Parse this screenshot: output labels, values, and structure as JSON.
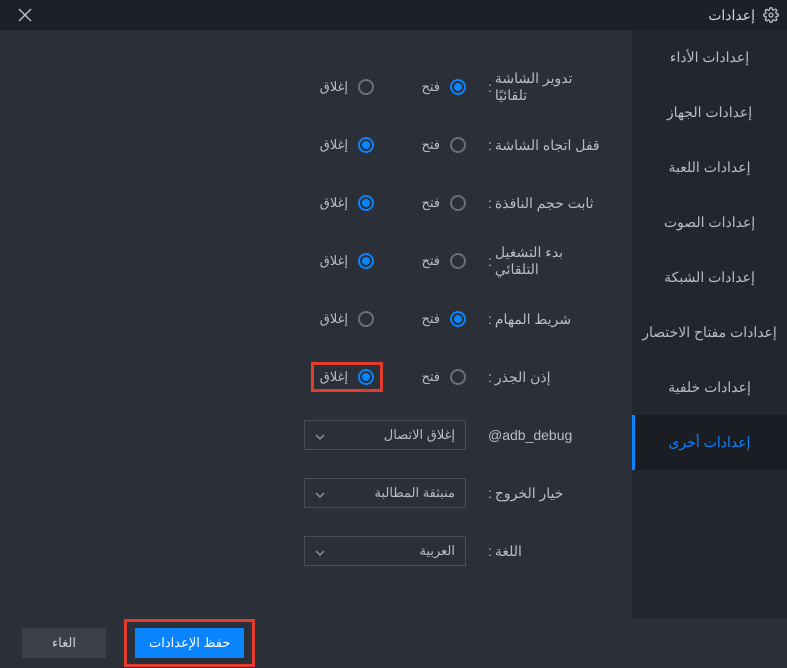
{
  "window": {
    "title": "إعدادات"
  },
  "sidebar": {
    "items": [
      {
        "label": "إعدادات الأداء"
      },
      {
        "label": "إعدادات الجهاز"
      },
      {
        "label": "إعدادات اللعبة"
      },
      {
        "label": "إعدادات الصوت"
      },
      {
        "label": "إعدادات الشبكة"
      },
      {
        "label": "إعدادات مفتاح الاختصار"
      },
      {
        "label": "إعدادات خلفية"
      },
      {
        "label": "إعدادات أخرى"
      }
    ]
  },
  "radios": {
    "open": "فتح",
    "close": "إغلاق"
  },
  "settings": {
    "auto_rotate": {
      "label": "تدوير الشاشة تلقائيًا",
      "value": "open"
    },
    "lock_orientation": {
      "label": "قفل اتجاه الشاشة",
      "value": "close"
    },
    "fixed_window": {
      "label": "ثابت حجم النافذة",
      "value": "close"
    },
    "auto_start": {
      "label": "بدء التشغيل التلقائي",
      "value": "close"
    },
    "taskbar": {
      "label": "شريط المهام",
      "value": "open"
    },
    "root": {
      "label": "إذن الجذر",
      "value": "close"
    },
    "adb": {
      "label": "@adb_debug",
      "selected": "إغلاق الاتصال"
    },
    "exit": {
      "label": "خيار الخروج",
      "selected": "منبثقة المطالبة"
    },
    "lang": {
      "label": "اللغة",
      "selected": "العربية"
    }
  },
  "footer": {
    "save": "حفظ الإعدادات",
    "cancel": "الغاء"
  }
}
